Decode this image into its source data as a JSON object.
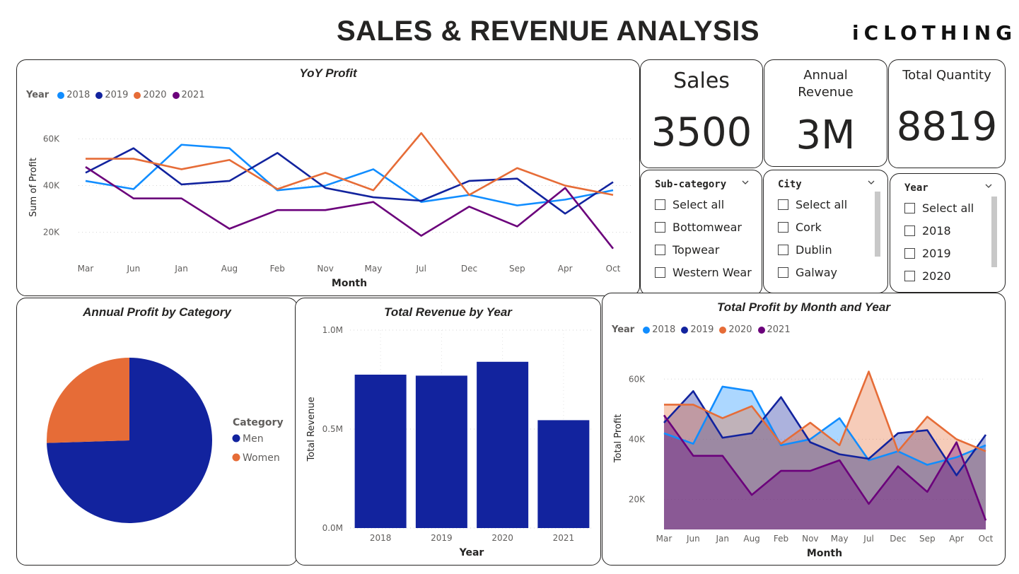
{
  "header": {
    "title": "SALES & REVENUE ANALYSIS",
    "brand": "iCLOTHING"
  },
  "kpis": [
    {
      "label": "Sales",
      "value": "3500"
    },
    {
      "label": "Annual Revenue",
      "value": "3M"
    },
    {
      "label": "Total Quantity",
      "value": "8819"
    }
  ],
  "slicers": {
    "subcategory": {
      "title": "Sub-category",
      "items": [
        "Select all",
        "Bottomwear",
        "Topwear",
        "Western Wear"
      ]
    },
    "city": {
      "title": "City",
      "items": [
        "Select all",
        "Cork",
        "Dublin",
        "Galway"
      ]
    },
    "year": {
      "title": "Year",
      "items": [
        "Select all",
        "2018",
        "2019",
        "2020"
      ]
    }
  },
  "colors": {
    "2018": "#118DFF",
    "2019": "#12239E",
    "2020": "#E66C37",
    "2021": "#6B007B",
    "Men": "#12239E",
    "Women": "#E66C37"
  },
  "chart_data": [
    {
      "type": "line",
      "title": "YoY Profit",
      "legend_title": "Year",
      "xlabel": "Month",
      "ylabel": "Sum of Profit",
      "categories": [
        "Mar",
        "Jun",
        "Jan",
        "Aug",
        "Feb",
        "Nov",
        "May",
        "Jul",
        "Dec",
        "Sep",
        "Apr",
        "Oct"
      ],
      "y_ticks": [
        "20K",
        "40K",
        "60K"
      ],
      "ylim": [
        12000,
        65000
      ],
      "grid": true,
      "legend_position": "top-left",
      "series": [
        {
          "name": "2018",
          "values": [
            42000,
            38500,
            57500,
            56000,
            38000,
            40000,
            47000,
            33000,
            36000,
            31500,
            34000,
            38000
          ]
        },
        {
          "name": "2019",
          "values": [
            45500,
            56000,
            40500,
            42000,
            54000,
            39000,
            35000,
            33500,
            42000,
            43000,
            28000,
            41500
          ]
        },
        {
          "name": "2020",
          "values": [
            51500,
            51500,
            47000,
            51000,
            38500,
            45500,
            38000,
            62500,
            36000,
            47500,
            40000,
            36000
          ]
        },
        {
          "name": "2021",
          "values": [
            48000,
            34500,
            34500,
            21500,
            29500,
            29500,
            33000,
            18500,
            31000,
            22500,
            39000,
            13000
          ]
        }
      ]
    },
    {
      "type": "pie",
      "title": "Annual Profit by Category",
      "legend_title": "Category",
      "legend_position": "right",
      "categories": [
        "Men",
        "Women"
      ],
      "values": [
        74.5,
        25.5
      ]
    },
    {
      "type": "bar",
      "title": "Total Revenue by Year",
      "xlabel": "Year",
      "ylabel": "Total Revenue",
      "categories": [
        "2018",
        "2019",
        "2020",
        "2021"
      ],
      "values": [
        775000,
        770000,
        840000,
        545000
      ],
      "y_ticks": [
        "0.0M",
        "0.5M",
        "1.0M"
      ],
      "ylim": [
        0,
        1000000
      ],
      "grid": true
    },
    {
      "type": "area",
      "title": "Total Profit by Month and Year",
      "legend_title": "Year",
      "xlabel": "Month",
      "ylabel": "Total Profit",
      "categories": [
        "Mar",
        "Jun",
        "Jan",
        "Aug",
        "Feb",
        "Nov",
        "May",
        "Jul",
        "Dec",
        "Sep",
        "Apr",
        "Oct"
      ],
      "y_ticks": [
        "20K",
        "40K",
        "60K"
      ],
      "ylim": [
        10000,
        65000
      ],
      "grid": true,
      "legend_position": "top-left",
      "series": [
        {
          "name": "2018",
          "values": [
            42000,
            38500,
            57500,
            56000,
            38000,
            40000,
            47000,
            33000,
            36000,
            31500,
            34000,
            38000
          ]
        },
        {
          "name": "2019",
          "values": [
            45500,
            56000,
            40500,
            42000,
            54000,
            39000,
            35000,
            33500,
            42000,
            43000,
            28000,
            41500
          ]
        },
        {
          "name": "2020",
          "values": [
            51500,
            51500,
            47000,
            51000,
            38500,
            45500,
            38000,
            62500,
            36000,
            47500,
            40000,
            36000
          ]
        },
        {
          "name": "2021",
          "values": [
            48000,
            34500,
            34500,
            21500,
            29500,
            29500,
            33000,
            18500,
            31000,
            22500,
            39000,
            13000
          ]
        }
      ]
    }
  ]
}
